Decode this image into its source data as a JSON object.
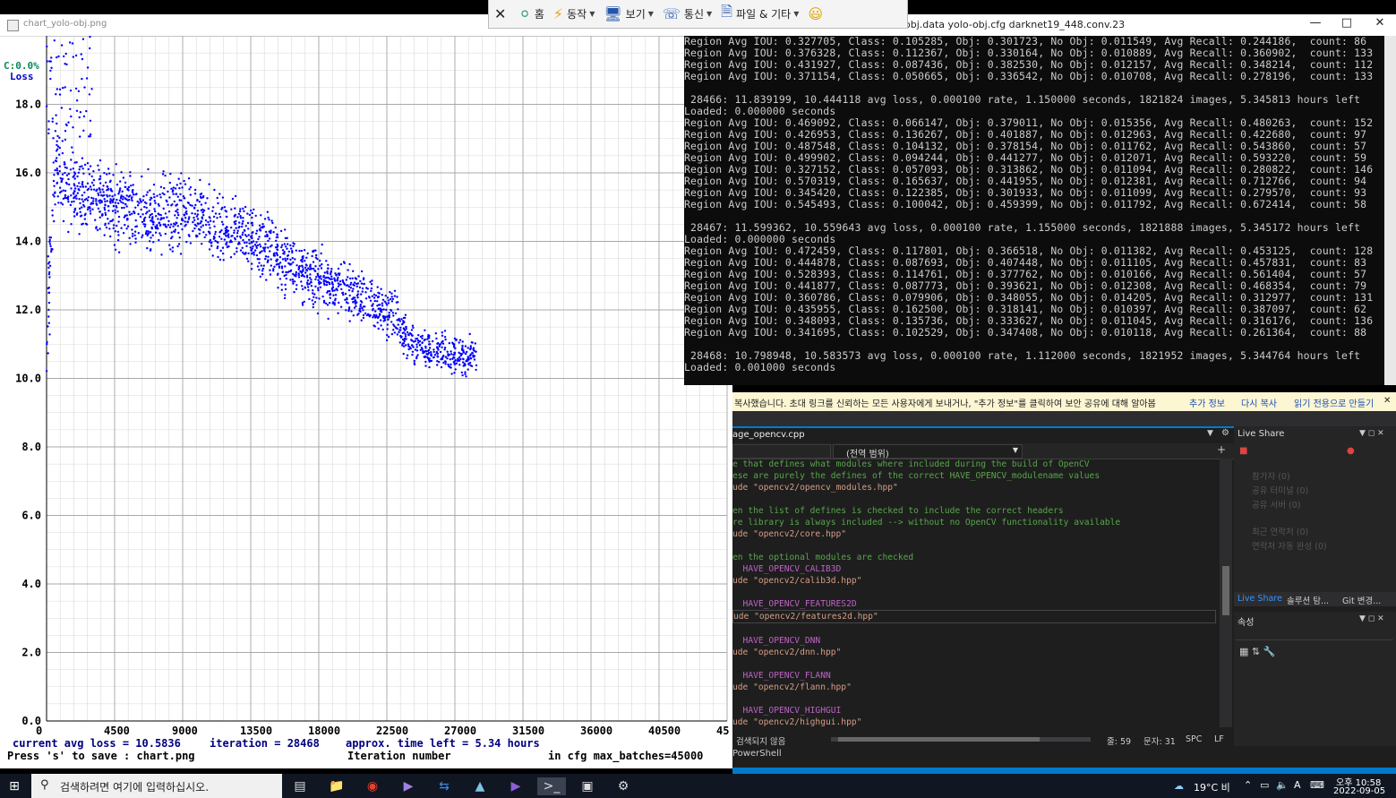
{
  "chart_window": {
    "title": "chart_yolo-obj.png",
    "corner_label": "C:0.0%",
    "loss_label": "Loss",
    "footer_avg_loss": "current avg loss = 10.5836",
    "footer_iteration": "iteration = 28468",
    "footer_time_left": "approx. time left = 5.34 hours",
    "footer_save": "Press 's' to save : chart.png",
    "footer_xlabel": "Iteration number",
    "footer_max_batches": "in cfg max_batches=45000"
  },
  "chart_data": {
    "type": "scatter",
    "title": "",
    "xlabel": "Iteration number",
    "ylabel": "Loss",
    "xlim": [
      0,
      45000
    ],
    "ylim": [
      0,
      20
    ],
    "grid": true,
    "point_color": "#0000ff",
    "x_ticks": [
      "0",
      "4500",
      "9000",
      "13500",
      "18000",
      "22500",
      "27000",
      "31500",
      "36000",
      "40500",
      "45"
    ],
    "y_ticks": [
      "0.0",
      "2.0",
      "4.0",
      "6.0",
      "8.0",
      "10.0",
      "12.0",
      "14.0",
      "16.0",
      "18.0"
    ],
    "series": [
      {
        "x": [
          0,
          500,
          1000,
          1500,
          2000,
          3000,
          4000,
          5000,
          6000,
          7000,
          8000,
          9000,
          10000,
          11000,
          12000,
          13000,
          14000,
          15000,
          16000,
          17000,
          18000,
          19000,
          20000,
          21000,
          22000,
          23000,
          24000,
          25000,
          26000,
          27000,
          28468
        ],
        "y": [
          11.0,
          16.2,
          15.8,
          15.6,
          15.5,
          15.3,
          15.2,
          15.0,
          14.8,
          14.8,
          14.9,
          14.9,
          14.8,
          14.6,
          14.4,
          14.2,
          14.0,
          13.7,
          13.3,
          13.1,
          12.9,
          12.7,
          12.5,
          12.3,
          12.1,
          11.8,
          11.0,
          10.9,
          10.8,
          10.7,
          10.6
        ],
        "spread": [
          1.5,
          1.5,
          1.2,
          1.1,
          1.1,
          1.0,
          1.0,
          1.0,
          1.0,
          1.0,
          1.0,
          1.0,
          1.0,
          0.9,
          0.9,
          0.9,
          0.9,
          0.9,
          0.8,
          0.8,
          0.8,
          0.8,
          0.8,
          0.7,
          0.7,
          0.7,
          0.6,
          0.5,
          0.5,
          0.5,
          0.5
        ]
      }
    ]
  },
  "remote_toolbar": {
    "close_icon": "close-icon",
    "home_label": "홈",
    "action_label": "동작",
    "view_label": "보기",
    "comm_label": "통신",
    "file_label": "파일 & 기타",
    "emoji": "😃"
  },
  "console_window": {
    "title": "obj.data yolo-obj.cfg darknet19_448.conv.23",
    "lines": [
      "Region Avg IOU: 0.327705, Class: 0.105285, Obj: 0.301723, No Obj: 0.011549, Avg Recall: 0.244186,  count: 86",
      "Region Avg IOU: 0.376328, Class: 0.112367, Obj: 0.330164, No Obj: 0.010889, Avg Recall: 0.360902,  count: 133",
      "Region Avg IOU: 0.431927, Class: 0.087436, Obj: 0.382530, No Obj: 0.012157, Avg Recall: 0.348214,  count: 112",
      "Region Avg IOU: 0.371154, Class: 0.050665, Obj: 0.336542, No Obj: 0.010708, Avg Recall: 0.278196,  count: 133",
      "",
      " 28466: 11.839199, 10.444118 avg loss, 0.000100 rate, 1.150000 seconds, 1821824 images, 5.345813 hours left",
      "Loaded: 0.000000 seconds",
      "Region Avg IOU: 0.469092, Class: 0.066147, Obj: 0.379011, No Obj: 0.015356, Avg Recall: 0.480263,  count: 152",
      "Region Avg IOU: 0.426953, Class: 0.136267, Obj: 0.401887, No Obj: 0.012963, Avg Recall: 0.422680,  count: 97",
      "Region Avg IOU: 0.487548, Class: 0.104132, Obj: 0.378154, No Obj: 0.011762, Avg Recall: 0.543860,  count: 57",
      "Region Avg IOU: 0.499902, Class: 0.094244, Obj: 0.441277, No Obj: 0.012071, Avg Recall: 0.593220,  count: 59",
      "Region Avg IOU: 0.327152, Class: 0.057093, Obj: 0.313862, No Obj: 0.011094, Avg Recall: 0.280822,  count: 146",
      "Region Avg IOU: 0.570319, Class: 0.165637, Obj: 0.441955, No Obj: 0.012381, Avg Recall: 0.712766,  count: 94",
      "Region Avg IOU: 0.345420, Class: 0.122385, Obj: 0.301933, No Obj: 0.011099, Avg Recall: 0.279570,  count: 93",
      "Region Avg IOU: 0.545493, Class: 0.100042, Obj: 0.459399, No Obj: 0.011792, Avg Recall: 0.672414,  count: 58",
      "",
      " 28467: 11.599362, 10.559643 avg loss, 0.000100 rate, 1.155000 seconds, 1821888 images, 5.345172 hours left",
      "Loaded: 0.000000 seconds",
      "Region Avg IOU: 0.472459, Class: 0.117801, Obj: 0.366518, No Obj: 0.011382, Avg Recall: 0.453125,  count: 128",
      "Region Avg IOU: 0.444878, Class: 0.087693, Obj: 0.407448, No Obj: 0.011105, Avg Recall: 0.457831,  count: 83",
      "Region Avg IOU: 0.528393, Class: 0.114761, Obj: 0.377762, No Obj: 0.010166, Avg Recall: 0.561404,  count: 57",
      "Region Avg IOU: 0.441877, Class: 0.087773, Obj: 0.393621, No Obj: 0.012308, Avg Recall: 0.468354,  count: 79",
      "Region Avg IOU: 0.360786, Class: 0.079906, Obj: 0.348055, No Obj: 0.014205, Avg Recall: 0.312977,  count: 131",
      "Region Avg IOU: 0.435955, Class: 0.162500, Obj: 0.318141, No Obj: 0.010397, Avg Recall: 0.387097,  count: 62",
      "Region Avg IOU: 0.348093, Class: 0.135736, Obj: 0.333627, No Obj: 0.011045, Avg Recall: 0.316176,  count: 136",
      "Region Avg IOU: 0.341695, Class: 0.102529, Obj: 0.347408, No Obj: 0.010118, Avg Recall: 0.261364,  count: 88",
      "",
      " 28468: 10.798948, 10.583573 avg loss, 0.000100 rate, 1.112000 seconds, 1821952 images, 5.344764 hours left",
      "Loaded: 0.001000 seconds"
    ]
  },
  "info_bar": {
    "message": "복사했습니다. 초대 링크를 신뢰하는 모든 사용자에게 보내거나, \"추가 정보\"를 클릭하여 보안 공유에 대해 알아봅",
    "more_info": "추가 정보",
    "copy_again": "다시 복사",
    "make_readonly": "읽기 전용으로 만들기"
  },
  "editor": {
    "tab_name": "age_opencv.cpp",
    "scope": "(전역 범위)",
    "code": [
      {
        "t": "e that defines what modules where included during the build of OpenCV",
        "k": "comment"
      },
      {
        "t": "ese are purely the defines of the correct HAVE_OPENCV_modulename values",
        "k": "comment"
      },
      {
        "t": "ude \"opencv2/opencv_modules.hpp\"",
        "k": "string"
      },
      {
        "t": "",
        "k": ""
      },
      {
        "t": "en the list of defines is checked to include the correct headers",
        "k": "comment"
      },
      {
        "t": "re library is always included --> without no OpenCV functionality available",
        "k": "comment"
      },
      {
        "t": "ude \"opencv2/core.hpp\"",
        "k": "string"
      },
      {
        "t": "",
        "k": ""
      },
      {
        "t": "en the optional modules are checked",
        "k": "comment"
      },
      {
        "t": "  HAVE_OPENCV_CALIB3D",
        "k": "macro"
      },
      {
        "t": "ude \"opencv2/calib3d.hpp\"",
        "k": "string"
      },
      {
        "t": "",
        "k": ""
      },
      {
        "t": "  HAVE_OPENCV_FEATURES2D",
        "k": "macro"
      },
      {
        "t": "ude \"opencv2/features2d.hpp\"",
        "k": "string hl"
      },
      {
        "t": "",
        "k": ""
      },
      {
        "t": "  HAVE_OPENCV_DNN",
        "k": "macro"
      },
      {
        "t": "ude \"opencv2/dnn.hpp\"",
        "k": "string"
      },
      {
        "t": "",
        "k": ""
      },
      {
        "t": "  HAVE_OPENCV_FLANN",
        "k": "macro"
      },
      {
        "t": "ude \"opencv2/flann.hpp\"",
        "k": "string"
      },
      {
        "t": "",
        "k": ""
      },
      {
        "t": "  HAVE_OPENCV_HIGHGUI",
        "k": "macro"
      },
      {
        "t": "ude \"opencv2/highgui.hpp\"",
        "k": "string"
      }
    ],
    "status_issues": "검색되지 않음",
    "status_line": "줄: 59",
    "status_col": "문자: 31",
    "status_spc": "SPC",
    "status_lf": "LF",
    "bottom_tab": "PowerShell"
  },
  "liveshare": {
    "title": "Live Share",
    "items": [
      "참가자 (0)",
      "공유 터미널 (0)",
      "공유 서버 (0)",
      "최근 연락처 (0)",
      "연락처 자동 완성 (0)"
    ],
    "tabs": [
      "Live Share",
      "솔루션 탐...",
      "Git 변경..."
    ],
    "props_title": "속성"
  },
  "taskbar": {
    "search_placeholder": "검색하려면 여기에 입력하십시오.",
    "weather": "19°C 비",
    "ime": "A",
    "time": "오후 10:58",
    "date": "2022-09-05"
  }
}
